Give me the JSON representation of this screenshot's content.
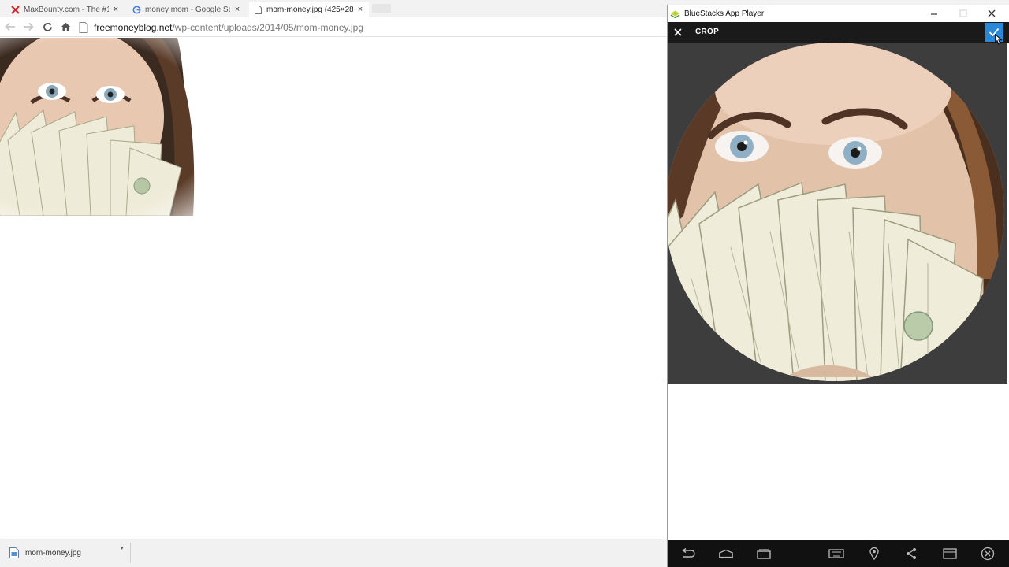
{
  "browser": {
    "tabs": [
      {
        "title": "MaxBounty.com - The #1",
        "icon": "maxbounty-x-icon",
        "active": false
      },
      {
        "title": "money mom - Google Se",
        "icon": "google-g-icon",
        "active": false
      },
      {
        "title": "mom-money.jpg (425×28",
        "icon": "page-icon",
        "active": true
      }
    ],
    "url": {
      "host": "freemoneyblog.net",
      "path": "/wp-content/uploads/2014/05/mom-money.jpg"
    },
    "download": {
      "filename": "mom-money.jpg"
    }
  },
  "bluestacks": {
    "window_title": "BlueStacks App Player",
    "crop_title": "CROP",
    "nav_icons": [
      "back-icon",
      "home-icon",
      "recent-apps-icon",
      "keyboard-icon",
      "location-icon",
      "share-icon",
      "screen-icon",
      "close-circle-icon"
    ]
  },
  "colors": {
    "accent": "#2a88d8",
    "appbar": "#1a1a1a",
    "navbar": "#111111"
  }
}
